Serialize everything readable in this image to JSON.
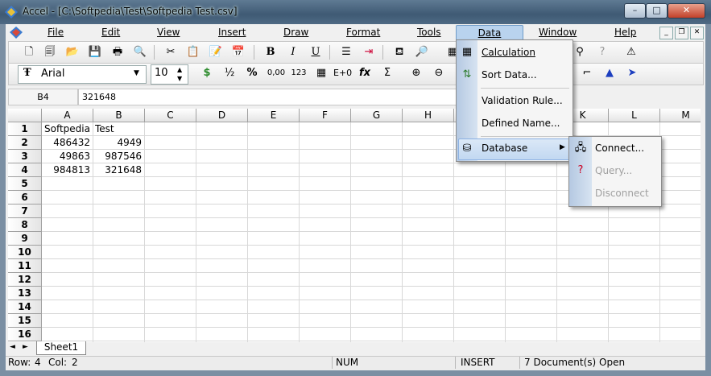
{
  "window": {
    "title": "Accel - [C:\\Softpedia\\Test\\Softpedia Test.csv]",
    "controls": {
      "minimize": "–",
      "maximize": "□",
      "close": "✕"
    }
  },
  "menubar": {
    "items": [
      "File",
      "Edit",
      "View",
      "Insert",
      "Draw",
      "Format",
      "Tools",
      "Data",
      "Window",
      "Help"
    ],
    "active": "Data",
    "mdi_controls": {
      "minimize": "_",
      "restore": "❐",
      "close": "✕"
    }
  },
  "toolbar2": {
    "font_name": "Arial",
    "font_size": "10"
  },
  "formula_bar": {
    "cell_ref": "B4",
    "value": "321648"
  },
  "grid": {
    "columns": [
      "A",
      "B",
      "C",
      "D",
      "E",
      "F",
      "G",
      "H",
      "I",
      "J",
      "K",
      "L",
      "M"
    ],
    "rows": [
      "1",
      "2",
      "3",
      "4",
      "5",
      "6",
      "7",
      "8",
      "9",
      "10",
      "11",
      "12",
      "13",
      "14",
      "15",
      "16"
    ],
    "cells": {
      "A1": "Softpedia",
      "B1": "Test",
      "A2": "486432",
      "B2": "4949",
      "A3": "49863",
      "B3": "987546",
      "A4": "984813",
      "B4": "321648"
    }
  },
  "sheets": {
    "tab": "Sheet1"
  },
  "status": {
    "row_label": "Row:",
    "row": "4",
    "col_label": "Col:",
    "col": "2",
    "num": "NUM",
    "insert": "INSERT",
    "documents": "7 Document(s) Open"
  },
  "data_menu": {
    "items": [
      "Calculation",
      "Sort Data...",
      "Validation Rule...",
      "Defined Name...",
      "Database"
    ]
  },
  "database_submenu": {
    "items": [
      "Connect...",
      "Query...",
      "Disconnect"
    ],
    "disabled": [
      "Query...",
      "Disconnect"
    ]
  },
  "colors": {
    "menu_highlight": "#b9d3ee",
    "gutter": "#c5d6ec",
    "titlebar": "#4f6a84"
  }
}
